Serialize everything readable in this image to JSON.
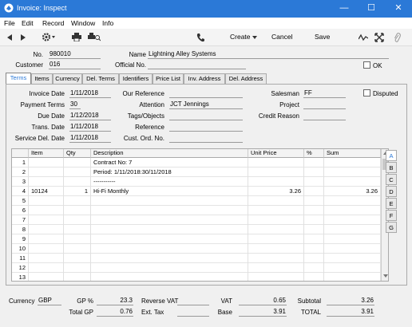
{
  "window": {
    "title": "Invoice: Inspect",
    "minimize": "—",
    "maximize": "☐",
    "close": "✕"
  },
  "menu": [
    "File",
    "Edit",
    "Record",
    "Window",
    "Info"
  ],
  "toolbar": {
    "create": "Create",
    "cancel": "Cancel",
    "save": "Save"
  },
  "header": {
    "no_label": "No.",
    "no": "980010",
    "name_label": "Name",
    "name": "Lightning Alley Systems",
    "customer_label": "Customer",
    "customer": "016",
    "official_label": "Official No.",
    "official": "",
    "ok_label": "OK"
  },
  "tabs": [
    "Terms",
    "Items",
    "Currency",
    "Del. Terms",
    "Identifiers",
    "Price List",
    "Inv. Address",
    "Del. Address"
  ],
  "terms": {
    "invoice_date_label": "Invoice Date",
    "invoice_date": "1/11/2018",
    "payment_terms_label": "Payment Terms",
    "payment_terms": "30",
    "due_date_label": "Due Date",
    "due_date": "1/12/2018",
    "trans_date_label": "Trans. Date",
    "trans_date": "1/11/2018",
    "service_del_label": "Service Del. Date",
    "service_del": "1/11/2018",
    "our_ref_label": "Our Reference",
    "our_ref": "",
    "attention_label": "Attention",
    "attention": "JCT Jennings",
    "tags_label": "Tags/Objects",
    "tags": "",
    "reference_label": "Reference",
    "reference": "",
    "cust_ord_label": "Cust. Ord. No.",
    "cust_ord": "",
    "salesman_label": "Salesman",
    "salesman": "FF",
    "project_label": "Project",
    "project": "",
    "credit_label": "Credit Reason",
    "credit": "",
    "disputed_label": "Disputed"
  },
  "grid": {
    "columns": [
      "Item",
      "Qty",
      "Description",
      "Unit Price",
      "%",
      "Sum"
    ],
    "rows": [
      [
        "1",
        "",
        "",
        "Contract No: 7",
        "",
        "",
        ""
      ],
      [
        "2",
        "",
        "",
        "Period: 1/11/2018:30/11/2018",
        "",
        "",
        ""
      ],
      [
        "3",
        "",
        "",
        "-----------",
        "",
        "",
        ""
      ],
      [
        "4",
        "10124",
        "1",
        "Hi-Fi Monthly",
        "3.26",
        "",
        "3.26"
      ],
      [
        "5",
        "",
        "",
        "",
        "",
        "",
        ""
      ],
      [
        "6",
        "",
        "",
        "",
        "",
        "",
        ""
      ],
      [
        "7",
        "",
        "",
        "",
        "",
        "",
        ""
      ],
      [
        "8",
        "",
        "",
        "",
        "",
        "",
        ""
      ],
      [
        "9",
        "",
        "",
        "",
        "",
        "",
        ""
      ],
      [
        "10",
        "",
        "",
        "",
        "",
        "",
        ""
      ],
      [
        "11",
        "",
        "",
        "",
        "",
        "",
        ""
      ],
      [
        "12",
        "",
        "",
        "",
        "",
        "",
        ""
      ],
      [
        "13",
        "",
        "",
        "",
        "",
        "",
        ""
      ]
    ],
    "side_tabs": [
      "A",
      "B",
      "C",
      "D",
      "E",
      "F",
      "G"
    ]
  },
  "footer": {
    "currency_label": "Currency",
    "currency": "GBP",
    "gp_pct_label": "GP %",
    "gp_pct": "23.3",
    "total_gp_label": "Total GP",
    "total_gp": "0.76",
    "reverse_vat_label": "Reverse VAT",
    "reverse_vat": "",
    "ext_tax_label": "Ext. Tax",
    "ext_tax": "",
    "vat_label": "VAT",
    "vat": "0.65",
    "base_label": "Base",
    "base": "3.91",
    "subtotal_label": "Subtotal",
    "subtotal": "3.26",
    "total_label": "TOTAL",
    "total": "3.91"
  },
  "colors": {
    "titlebar": "#2b79d7",
    "accent": "#2b79d7"
  }
}
